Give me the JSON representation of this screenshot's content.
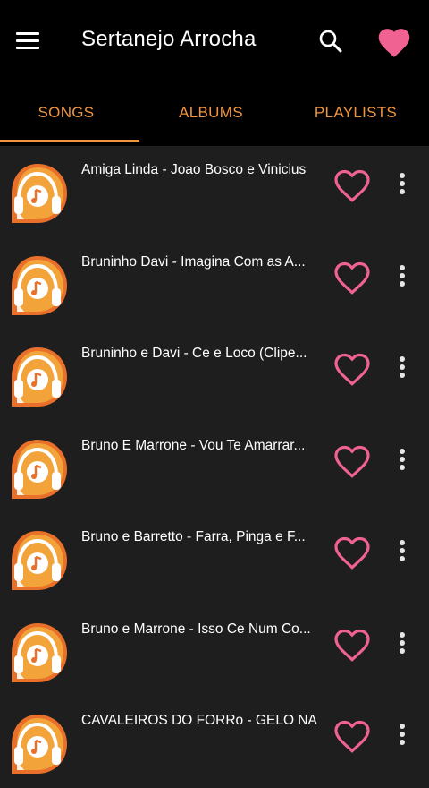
{
  "appbar": {
    "title": "Sertanejo Arrocha",
    "menu_icon": "hamburger-menu-icon",
    "search_icon": "search-icon",
    "favorites_icon": "heart-filled-icon"
  },
  "tabs": [
    {
      "label": "SONGS",
      "active": true
    },
    {
      "label": "ALBUMS",
      "active": false
    },
    {
      "label": "PLAYLISTS",
      "active": false
    }
  ],
  "songs": [
    {
      "title": "Amiga Linda - Joao Bosco e Vinicius"
    },
    {
      "title": "Bruninho  Davi - Imagina Com as A..."
    },
    {
      "title": "Bruninho e Davi - Ce e Loco (Clipe..."
    },
    {
      "title": "Bruno E Marrone - Vou Te Amarrar..."
    },
    {
      "title": "Bruno e Barretto - Farra, Pinga e F..."
    },
    {
      "title": "Bruno e Marrone - Isso Ce Num Co..."
    },
    {
      "title": "CAVALEIROS DO FORRo - GELO NA..."
    }
  ],
  "colors": {
    "accent": "#f0953f",
    "heart": "#f06292",
    "background": "#1e1e1e",
    "bar": "#000000"
  }
}
